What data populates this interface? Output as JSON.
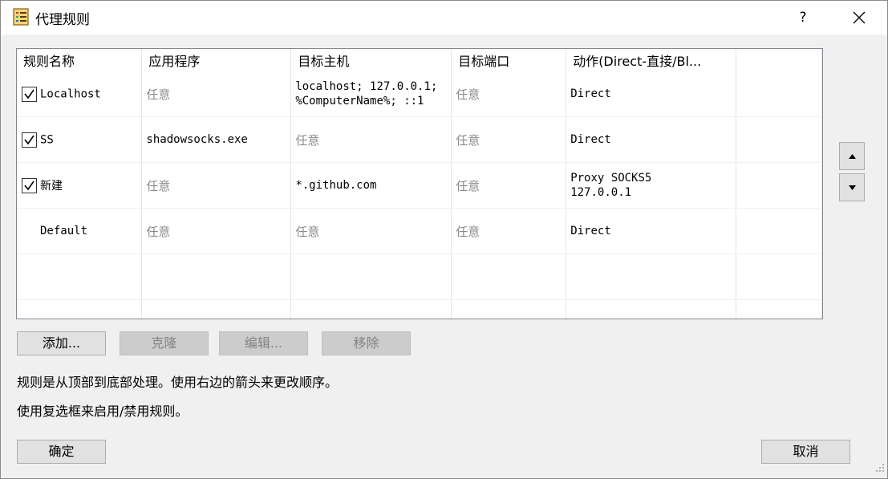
{
  "window": {
    "title": "代理规则",
    "help_label": "?"
  },
  "table": {
    "columns": [
      "规则名称",
      "应用程序",
      "目标主机",
      "目标端口",
      "动作(Direct-直接/Bl..."
    ],
    "rows": [
      {
        "checked": true,
        "name": "Localhost",
        "app": "任意",
        "host_line1": "localhost; 127.0.0.1;",
        "host_line2": "%ComputerName%; ::1",
        "port": "任意",
        "action_line1": "Direct",
        "action_line2": ""
      },
      {
        "checked": true,
        "name": "SS",
        "app": "shadowsocks.exe",
        "host_line1": "任意",
        "host_line2": "",
        "port": "任意",
        "action_line1": "Direct",
        "action_line2": ""
      },
      {
        "checked": true,
        "name": "新建",
        "app": "任意",
        "host_line1": "*.github.com",
        "host_line2": "",
        "port": "任意",
        "action_line1": "Proxy SOCKS5",
        "action_line2": "127.0.0.1"
      },
      {
        "checked": null,
        "name": "Default",
        "app": "任意",
        "host_line1": "任意",
        "host_line2": "",
        "port": "任意",
        "action_line1": "Direct",
        "action_line2": ""
      }
    ]
  },
  "buttons": {
    "add": "添加...",
    "clone": "克隆",
    "edit": "编辑...",
    "remove": "移除",
    "ok": "确定",
    "cancel": "取消"
  },
  "hints": {
    "order": "规则是从顶部到底部处理。使用右边的箭头来更改顺序。",
    "checkbox": "使用复选框来启用/禁用规则。"
  },
  "icons": {
    "app": "rules-list-icon",
    "move_up": "arrow-up-icon",
    "move_down": "arrow-down-icon",
    "close": "close-icon"
  }
}
